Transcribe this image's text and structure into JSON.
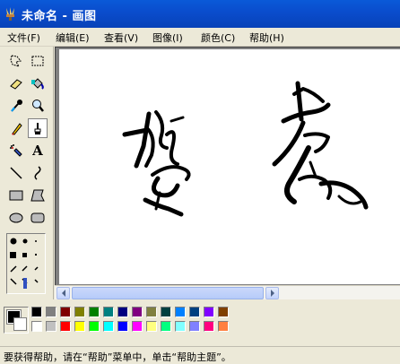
{
  "window": {
    "title": "未命名 - 画图"
  },
  "menu": [
    {
      "label": "文件(F)"
    },
    {
      "label": "编辑(E)"
    },
    {
      "label": "查看(V)"
    },
    {
      "label": "图像(I)"
    },
    {
      "label": "颜色(C)"
    },
    {
      "label": "帮助(H)"
    }
  ],
  "tools": [
    {
      "name": "free-select-icon"
    },
    {
      "name": "rect-select-icon"
    },
    {
      "name": "eraser-icon"
    },
    {
      "name": "fill-bucket-icon"
    },
    {
      "name": "eyedropper-icon"
    },
    {
      "name": "magnifier-icon"
    },
    {
      "name": "pencil-icon"
    },
    {
      "name": "brush-icon",
      "selected": true
    },
    {
      "name": "airbrush-icon"
    },
    {
      "name": "text-icon",
      "glyph": "A"
    },
    {
      "name": "line-icon"
    },
    {
      "name": "curve-icon"
    },
    {
      "name": "rectangle-icon"
    },
    {
      "name": "polygon-icon"
    },
    {
      "name": "ellipse-icon"
    },
    {
      "name": "rounded-rect-icon"
    }
  ],
  "colors": {
    "foreground": "#000000",
    "background": "#ffffff",
    "palette_row1": [
      "#000000",
      "#808080",
      "#800000",
      "#808000",
      "#008000",
      "#008080",
      "#000080",
      "#800080",
      "#808040",
      "#004040",
      "#0080ff",
      "#004080",
      "#8000ff",
      "#804000"
    ],
    "palette_row2": [
      "#ffffff",
      "#c0c0c0",
      "#ff0000",
      "#ffff00",
      "#00ff00",
      "#00ffff",
      "#0000ff",
      "#ff00ff",
      "#ffff80",
      "#00ff80",
      "#80ffff",
      "#8080ff",
      "#ff0080",
      "#ff8040"
    ]
  },
  "status": {
    "text": "要获得帮助，请在“帮助”菜单中，单击“帮助主题”。"
  }
}
